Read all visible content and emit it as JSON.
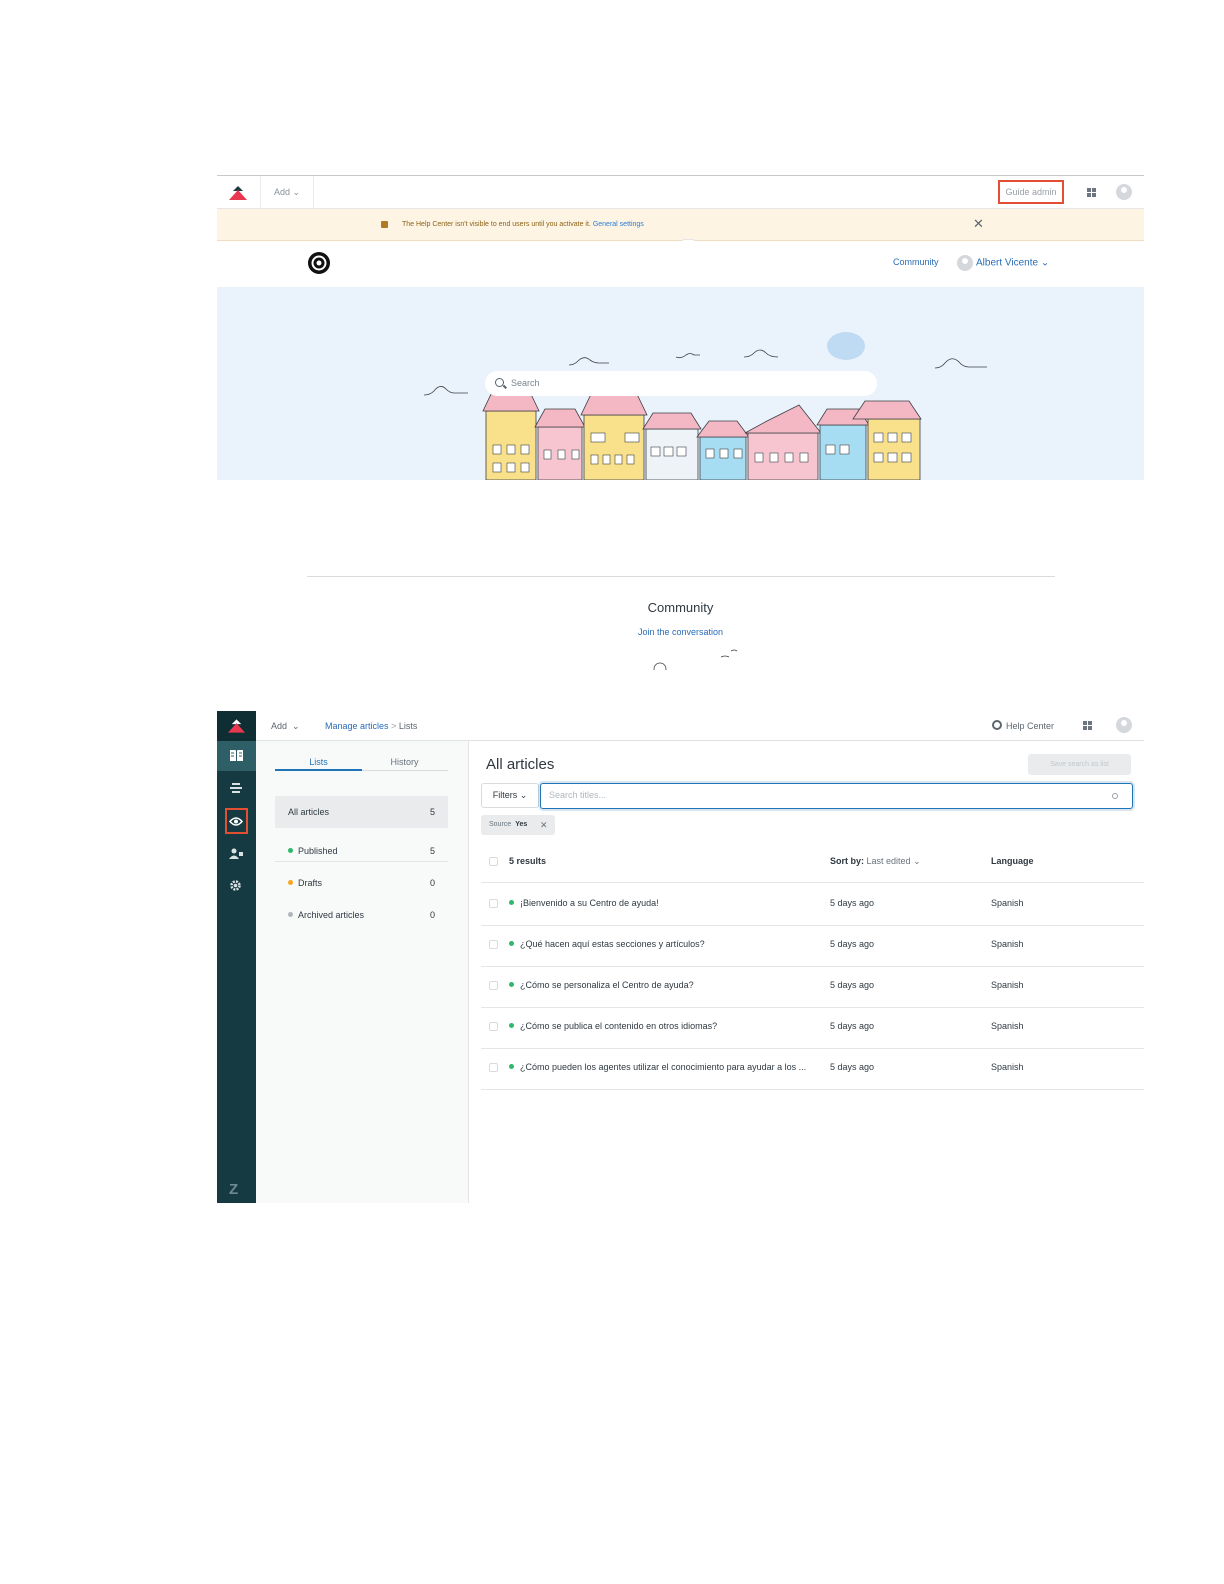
{
  "help_center": {
    "topbar": {
      "add_label": "Add",
      "guide_admin_label": "Guide admin"
    },
    "banner": {
      "text": "The Help Center isn't visible to end users until you activate it.",
      "link": "General settings",
      "close_glyph": "✕"
    },
    "header": {
      "community_link": "Community",
      "user_name": "Albert Vicente"
    },
    "hero": {
      "search_placeholder": "Search"
    },
    "community": {
      "title": "Community",
      "link": "Join the conversation"
    }
  },
  "guide_admin": {
    "topbar": {
      "add_label": "Add",
      "breadcrumb": {
        "link": "Manage articles",
        "separator": ">",
        "current": "Lists"
      },
      "help_center_label": "Help Center"
    },
    "rail": {
      "items": [
        {
          "icon": "book-icon",
          "active": true
        },
        {
          "icon": "arrange-content-icon",
          "active": false
        },
        {
          "icon": "eye-icon",
          "active": false,
          "highlighted": true
        },
        {
          "icon": "user-permissions-icon",
          "active": false
        },
        {
          "icon": "gear-icon",
          "active": false
        }
      ],
      "footer_logo": "Z"
    },
    "lists_panel": {
      "tabs": [
        {
          "label": "Lists",
          "active": true
        },
        {
          "label": "History",
          "active": false
        }
      ],
      "items": [
        {
          "label": "All articles",
          "count": "5",
          "selected": true
        },
        {
          "label": "Published",
          "count": "5",
          "dot_color": "#2fb76c"
        },
        {
          "label": "Drafts",
          "count": "0",
          "dot_color": "#f5a623"
        },
        {
          "label": "Archived articles",
          "count": "0",
          "dot_color": "#b0b7bd"
        }
      ]
    },
    "main": {
      "title": "All articles",
      "save_button": "Save search as list",
      "filters_button": "Filters ⌄",
      "search_placeholder": "Search titles...",
      "chip": {
        "label": "Source",
        "value": "Yes",
        "remove_glyph": "✕"
      },
      "table": {
        "results_label": "5 results",
        "sort_label": "Sort by:",
        "sort_value": "Last edited ⌄",
        "language_header": "Language",
        "rows": [
          {
            "title": "¡Bienvenido a su Centro de ayuda!",
            "edited": "5 days ago",
            "language": "Spanish"
          },
          {
            "title": "¿Qué hacen aquí estas secciones y artículos?",
            "edited": "5 days ago",
            "language": "Spanish"
          },
          {
            "title": "¿Cómo se personaliza el Centro de ayuda?",
            "edited": "5 days ago",
            "language": "Spanish"
          },
          {
            "title": "¿Cómo se publica el contenido en otros idiomas?",
            "edited": "5 days ago",
            "language": "Spanish"
          },
          {
            "title": "¿Cómo pueden los agentes utilizar el conocimiento para ayudar a los ...",
            "edited": "5 days ago",
            "language": "Spanish"
          }
        ]
      }
    }
  },
  "colors": {
    "highlight_border": "#e34f32",
    "rail_bg": "#163a41",
    "link_blue": "#2a6cb9",
    "primary_blue": "#1f73b7"
  }
}
